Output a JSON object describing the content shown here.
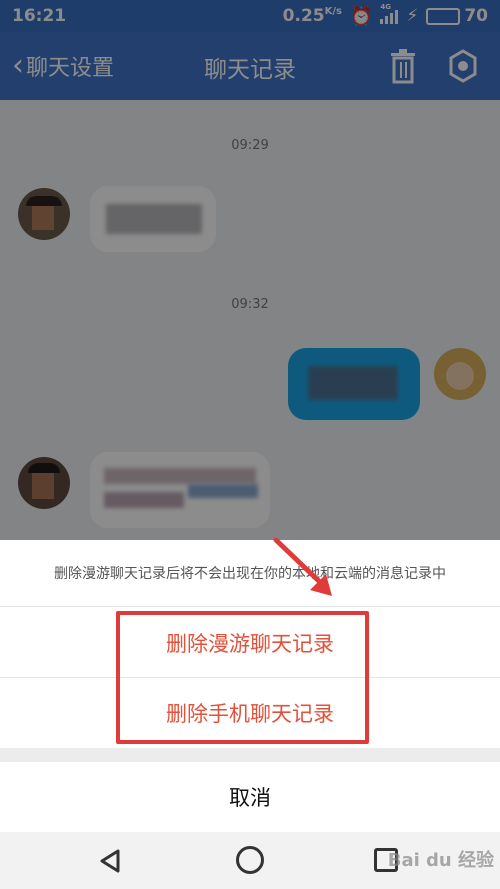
{
  "status_bar": {
    "time": "16:21",
    "speed": "0.25",
    "speed_unit": "K/s",
    "network": "4G",
    "battery": "70",
    "battery_level": 0.7
  },
  "header": {
    "back_label": "聊天设置",
    "title": "聊天记录"
  },
  "chat": {
    "timestamps": [
      "09:29",
      "09:32"
    ]
  },
  "sheet": {
    "note": "删除漫游聊天记录后将不会出现在你的本地和云端的消息记录中",
    "option_roaming": "删除漫游聊天记录",
    "option_phone": "删除手机聊天记录",
    "cancel": "取消"
  },
  "watermark": "Bai du 经验",
  "colors": {
    "header": "#3f74c9",
    "danger_text": "#e2523a",
    "annotation_red": "#e03b3b"
  }
}
